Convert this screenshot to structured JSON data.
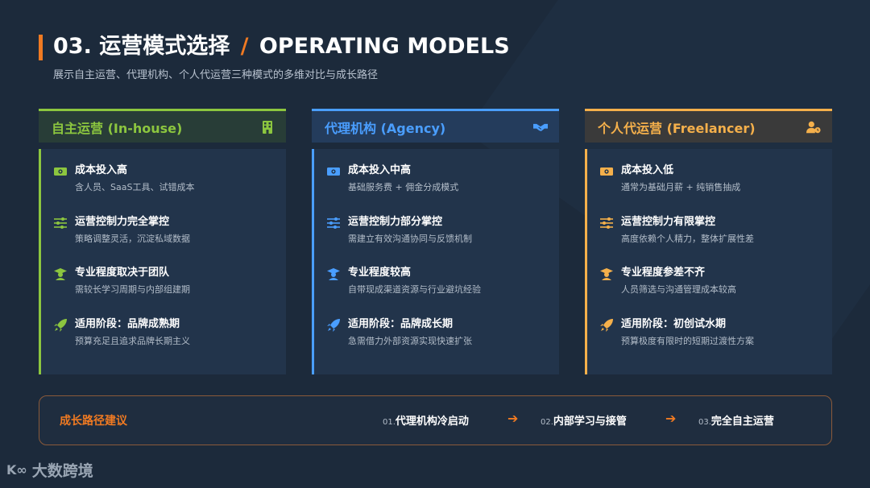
{
  "header": {
    "title_cn": "03. 运营模式选择",
    "title_sep": "/",
    "title_en": "OPERATING MODELS",
    "subtitle": "展示自主运营、代理机构、个人代运营三种模式的多维对比与成长路径"
  },
  "colors": {
    "accent": "#f07a22",
    "green": "#8cc63f",
    "blue": "#4a9eff",
    "orange": "#f5b04b"
  },
  "columns": [
    {
      "title": "自主运营 (In-house)",
      "header_icon": "building-icon",
      "items": [
        {
          "icon": "money-icon",
          "title": "成本投入高",
          "desc": "含人员、SaaS工具、试错成本"
        },
        {
          "icon": "sliders-icon",
          "title": "运营控制力完全掌控",
          "desc": "策略调整灵活，沉淀私域数据"
        },
        {
          "icon": "graduate-icon",
          "title": "专业程度取决于团队",
          "desc": "需较长学习周期与内部组建期"
        },
        {
          "icon": "rocket-icon",
          "title": "适用阶段：品牌成熟期",
          "desc": "预算充足且追求品牌长期主义"
        }
      ]
    },
    {
      "title": "代理机构 (Agency)",
      "header_icon": "handshake-icon",
      "items": [
        {
          "icon": "money-icon",
          "title": "成本投入中高",
          "desc": "基础服务费 + 佣金分成模式"
        },
        {
          "icon": "sliders-icon",
          "title": "运营控制力部分掌控",
          "desc": "需建立有效沟通协同与反馈机制"
        },
        {
          "icon": "graduate-icon",
          "title": "专业程度较高",
          "desc": "自带现成渠道资源与行业避坑经验"
        },
        {
          "icon": "rocket-icon",
          "title": "适用阶段：品牌成长期",
          "desc": "急需借力外部资源实现快速扩张"
        }
      ]
    },
    {
      "title": "个人代运营 (Freelancer)",
      "header_icon": "user-clock-icon",
      "items": [
        {
          "icon": "money-icon",
          "title": "成本投入低",
          "desc": "通常为基础月薪 + 纯销售抽成"
        },
        {
          "icon": "sliders-icon",
          "title": "运营控制力有限掌控",
          "desc": "高度依赖个人精力，整体扩展性差"
        },
        {
          "icon": "graduate-icon",
          "title": "专业程度参差不齐",
          "desc": "人员筛选与沟通管理成本较高"
        },
        {
          "icon": "rocket-icon",
          "title": "适用阶段：初创试水期",
          "desc": "预算极度有限时的短期过渡性方案"
        }
      ]
    }
  ],
  "growth_path": {
    "label": "成长路径建议",
    "steps": [
      {
        "num": "01.",
        "text": "代理机构冷启动"
      },
      {
        "num": "02.",
        "text": "内部学习与接管"
      },
      {
        "num": "03.",
        "text": "完全自主运营"
      }
    ],
    "arrow": "➔"
  },
  "logo": {
    "mark": "K∞",
    "text": "大数跨境"
  }
}
